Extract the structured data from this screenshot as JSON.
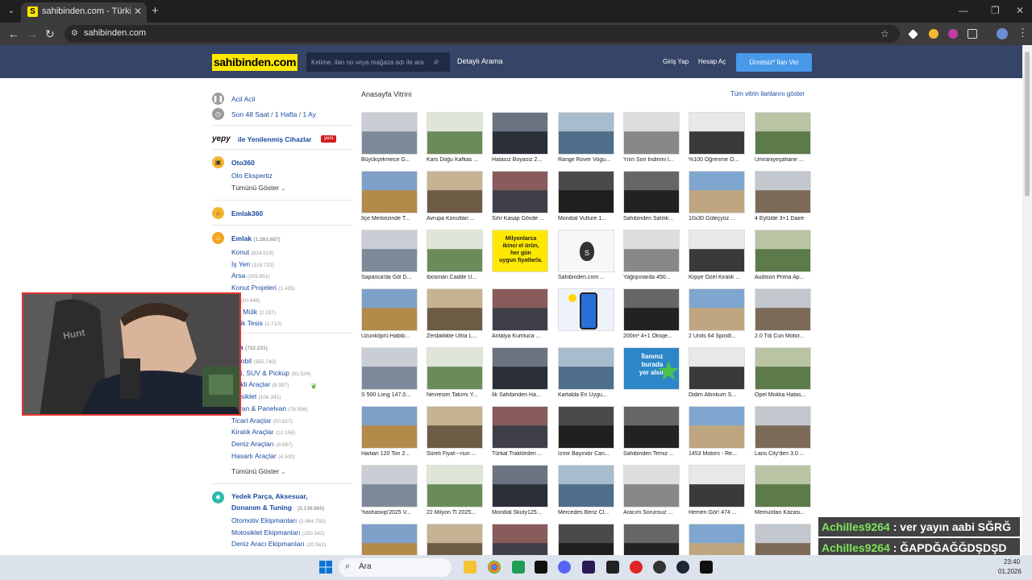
{
  "browser": {
    "tab_title": "sahibinden.com - Türkiye'nin O",
    "url": "sahibinden.com"
  },
  "header": {
    "logo": "sahibinden.com",
    "search_placeholder": "Kelime, ilan no veya mağaza adı ile ara",
    "advanced_search": "Detaylı Arama",
    "login": "Giriş Yap",
    "signup": "Hesap Aç",
    "post_ad": "Ücretsiz* İlan Ver",
    "colors": {
      "header_bg": "#354467",
      "logo_bg": "#ffe800",
      "cta_bg": "#489ae9"
    }
  },
  "sidebar": {
    "urgent": "Acil Acil",
    "recent": [
      "Son 48 Saat",
      "1 Hafta",
      "1 Ay"
    ],
    "recent_sep": "/",
    "yepy_logo": "yepy",
    "yepy_label": "ile Yenilenmiş Cihazlar",
    "yepy_badge": "yeni",
    "oto360": {
      "title": "Oto360",
      "items": [
        "Oto Ekspertiz"
      ],
      "show_all": "Tümünü Göster"
    },
    "emlak360": {
      "title": "Emlak360"
    },
    "emlak": {
      "title": "Emlak",
      "count": "(1.263.687)",
      "items": [
        {
          "label": "Konut",
          "count": "(824.519)"
        },
        {
          "label": "İş Yeri",
          "count": "(118.722)"
        },
        {
          "label": "Arsa",
          "count": "(305.951)"
        },
        {
          "label": "Konut Projeleri",
          "count": "(1.435)"
        },
        {
          "label": "sa",
          "count": "(10.448)"
        },
        {
          "label": "yre Mülk",
          "count": "(2.337)"
        },
        {
          "label": "ristik Tesis",
          "count": "(1.710)"
        }
      ]
    },
    "vasita": {
      "title": "sıta",
      "count": "(722.231)",
      "items": [
        {
          "label": "omobil",
          "count": "(355.740)"
        },
        {
          "label": "razi, SUV & Pickup",
          "count": "(91.524)"
        },
        {
          "label": "ktrikli Araçlar",
          "count": "(8.397)"
        },
        {
          "label": "otosiklet",
          "count": "(106.341)"
        },
        {
          "label": "inivan & Panelvan",
          "count": "(76.598)"
        },
        {
          "label": "Ticari Araçlar",
          "count": "(50.827)"
        },
        {
          "label": "Kiralık Araçlar",
          "count": "(10.156)"
        },
        {
          "label": "Deniz Araçları",
          "count": "(8.697)"
        },
        {
          "label": "Hasarlı Araçlar",
          "count": "(4.500)"
        }
      ],
      "show_all": "Tümünü Göster"
    },
    "parts": {
      "title_line1": "Yedek Parça, Aksesuar,",
      "title_line2": "Donanım & Tuning",
      "count": "(3.139.865)",
      "items": [
        {
          "label": "Otomotiv Ekipmanları",
          "count": "(2.964.755)"
        },
        {
          "label": "Motosiklet Ekipmanları",
          "count": "(150.542)"
        },
        {
          "label": "Deniz Aracı Ekipmanları",
          "count": "(20.561)"
        }
      ]
    }
  },
  "showcase": {
    "title": "Anasayfa Vitrini",
    "show_all": "Tüm vitrin ilanlarını göster",
    "promo_text": [
      "Milyonlarca",
      "ikinci el ürün,",
      "her gün",
      "uygun fiyatlarla."
    ],
    "promo_badge": [
      "İlanınız",
      "burada",
      "yer alsın"
    ],
    "rows": [
      [
        "Büyükçekmece G...",
        "Kars Doğu Kafkas ...",
        "Hatasız Boyasız 2...",
        "Range Rover Vogu...",
        "Yılın Son İndirimi İ...",
        "%100 Öğrenme O...",
        "Ümraniyeşahane ..."
      ],
      [
        "İlçe Merkezinde T...",
        "Avrupa Konutları ...",
        "Sıfır Kasap Gövde ...",
        "Mondial Vulture 1...",
        "Sahibinden Satılık...",
        "10x30 Güleçyüz ...",
        "4 Eylülde 3+1 Daire"
      ],
      [
        "Sapanca'da Göl D...",
        "İbosman Cadde Ü...",
        "",
        "Sahibinden.com ...",
        "Yağlıpınarda 450...",
        "Kişiye Özel Kiralık ...",
        "Audison Prima Ap..."
      ],
      [
        "Uzunköprü Habib...",
        "Zerdalilikte Ultra L...",
        "Antalya Kumluca ...",
        "",
        "200m² 4+1 Oksije...",
        "2 Units 64 Spindl...",
        "2.0 Tdi Cun Motor..."
      ],
      [
        "S 500 Long 147.0...",
        "Nevresim Takımı Y...",
        "İlk Sahibinden Ha...",
        "Kartalda En Uygu...",
        "",
        "Didim Altınkum S...",
        "Opel Mokka Hatas..."
      ],
      [
        "Haitian 120 Ton 2...",
        "Süreli Fiyat---nuri ...",
        "Türkal Traktörden ...",
        "İzmir Bayındır Can...",
        "Sahibinden Temiz ...",
        "1453 Motors - Re...",
        "Lans City'den 3.0 ..."
      ],
      [
        "'hashasvip'2025 V...",
        "22 Milyon Tl 2025...",
        "Mondial Skuty125...",
        "Mercedes Benz Cl...",
        "Aracım Sorunsuz ...",
        "Hemen Gör! 474 ...",
        "Memurdan Kazası..."
      ],
      [
        "",
        "",
        "",
        "",
        "",
        "",
        ""
      ]
    ]
  },
  "chat": [
    {
      "user": "Achilles9264",
      "sep": " : ",
      "text": "ver yayın aabi SĞRĞ"
    },
    {
      "user": "Achilles9264",
      "sep": " : ",
      "text": "ĞAPDĞAĞĞDŞDŞD"
    },
    {
      "user": "Achilles9264",
      "sep": " : ",
      "text": "ĞAPDĞAĞĞDŞDŞD"
    }
  ],
  "taskbar": {
    "search_label": "Ara",
    "time": "23:40",
    "date": "01.2026"
  }
}
